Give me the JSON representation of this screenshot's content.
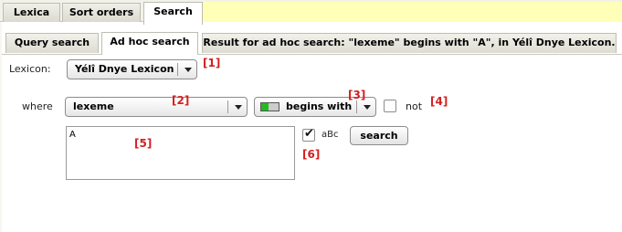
{
  "top_tabs": [
    {
      "label": "Lexica"
    },
    {
      "label": "Sort orders"
    },
    {
      "label": "Search"
    }
  ],
  "sub_tabs": [
    {
      "label": "Query search"
    },
    {
      "label": "Ad hoc search"
    },
    {
      "label": "Result for ad hoc search: \"lexeme\" begins with \"A\", in Yélî Dnye Lexicon."
    }
  ],
  "form": {
    "lexicon_label": "Lexicon:",
    "lexicon_value": "Yélî Dnye Lexicon",
    "where_label": "where",
    "field_value": "lexeme",
    "operator_value": "begins with",
    "operator_indicator_fill": 0.4,
    "not_label": "not",
    "not_checked": false,
    "query_text": "A",
    "case_label": "aBc",
    "case_checked": true,
    "search_button": "search"
  },
  "markers": [
    "[1]",
    "[2]",
    "[3]",
    "[4]",
    "[5]",
    "[6]"
  ],
  "colors": {
    "marker": "#d42020",
    "active_tab_strip": "#ffffb8",
    "indicator_green": "#22bb22"
  }
}
